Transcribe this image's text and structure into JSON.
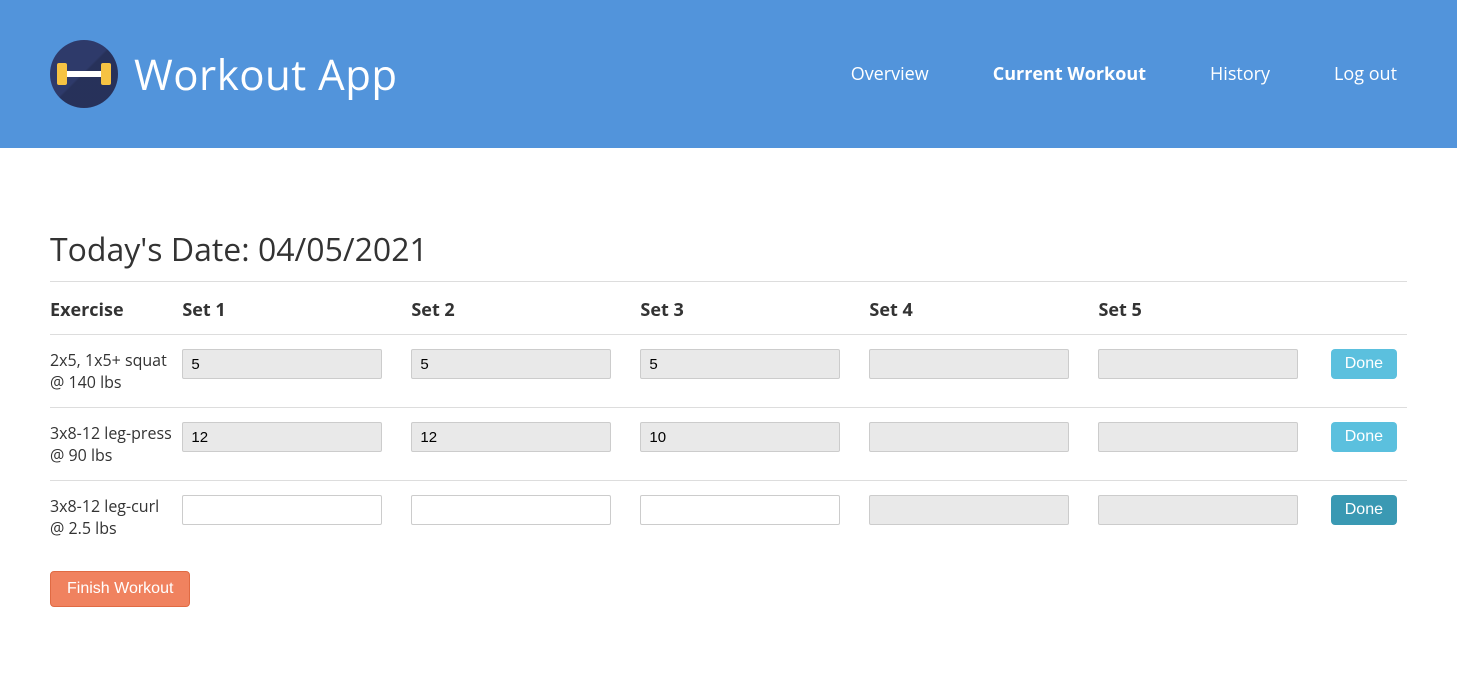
{
  "header": {
    "app_title": "Workout App",
    "nav": {
      "overview": "Overview",
      "current": "Current Workout",
      "history": "History",
      "logout": "Log out"
    }
  },
  "page": {
    "title": "Today's Date: 04/05/2021",
    "finish_label": "Finish Workout"
  },
  "table": {
    "col_exercise": "Exercise",
    "col_set1": "Set 1",
    "col_set2": "Set 2",
    "col_set3": "Set 3",
    "col_set4": "Set 4",
    "col_set5": "Set 5",
    "done_label": "Done"
  },
  "exercises": [
    {
      "name": "2x5, 1x5+ squat @ 140 lbs",
      "sets": {
        "s1": "5",
        "s2": "5",
        "s3": "5",
        "s4": "",
        "s5": ""
      },
      "active_sets": 3,
      "done_state": "normal"
    },
    {
      "name": "3x8-12 leg-press @ 90 lbs",
      "sets": {
        "s1": "12",
        "s2": "12",
        "s3": "10",
        "s4": "",
        "s5": ""
      },
      "active_sets": 3,
      "done_state": "normal"
    },
    {
      "name": "3x8-12 leg-curl @ 2.5 lbs",
      "sets": {
        "s1": "",
        "s2": "",
        "s3": "",
        "s4": "",
        "s5": ""
      },
      "active_sets": 3,
      "done_state": "dark"
    }
  ]
}
